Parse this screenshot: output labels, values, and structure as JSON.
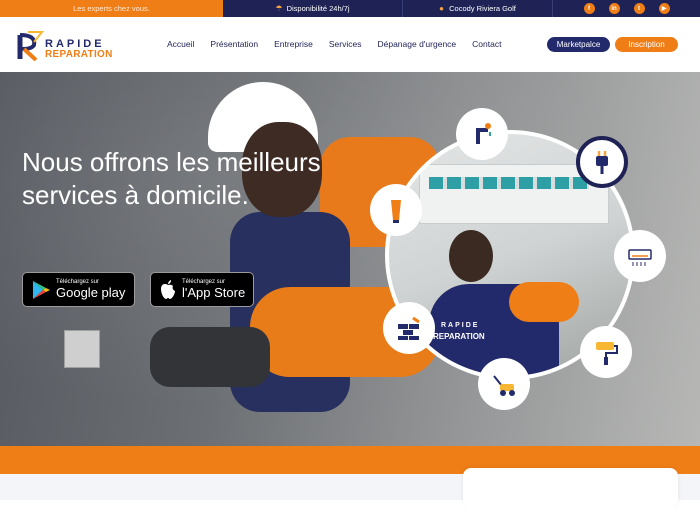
{
  "topbar": {
    "tagline": "Les experts chez vous.",
    "availability": "Disponibilité 24h/7j",
    "location": "Cocody Riviera Golf",
    "social": [
      {
        "name": "facebook",
        "glyph": "f"
      },
      {
        "name": "linkedin",
        "glyph": "in"
      },
      {
        "name": "twitter",
        "glyph": "t"
      },
      {
        "name": "youtube",
        "glyph": "▶"
      }
    ]
  },
  "brand": {
    "word1": "RAPIDE",
    "word2": "REPARATION",
    "colors": {
      "navy": "#1f2255",
      "orange": "#f07e16"
    }
  },
  "nav": {
    "items": [
      "Accueil",
      "Présentation",
      "Entreprise",
      "Services",
      "Dépanage d'urgence",
      "Contact"
    ],
    "marketplace": "Marketpalce",
    "signup": "Inscription"
  },
  "hero": {
    "headline": "Nous offrons les meilleurs services à domicile.",
    "google": {
      "small": "Téléchargez sur",
      "big": "Google play"
    },
    "apple": {
      "small": "Téléchargez sur",
      "big": "l'App Store"
    },
    "service_icons": [
      "plumbing-icon",
      "plug-icon",
      "saw-icon",
      "air-conditioner-icon",
      "bricks-icon",
      "paint-roller-icon",
      "lawn-mower-icon"
    ],
    "vest_logo": [
      "RAPIDE",
      "REPARATION"
    ]
  }
}
